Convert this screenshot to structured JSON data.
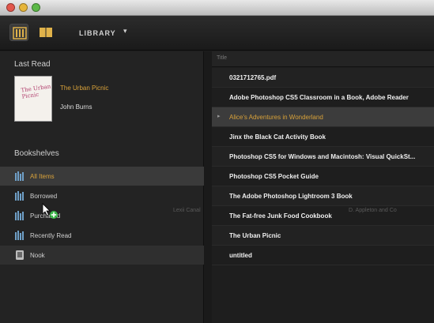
{
  "window": {
    "traffic_lights": [
      "close",
      "minimize",
      "zoom"
    ]
  },
  "toolbar": {
    "grid_view_icon": "bookshelf-grid-icon",
    "book_view_icon": "open-book-icon",
    "library_label": "LIBRARY",
    "library_caret": "▾"
  },
  "sidebar": {
    "last_read_title": "Last Read",
    "last_read": {
      "cover_text": "The Urban Picnic",
      "title": "The Urban Picnic",
      "author": "John Burns"
    },
    "bookshelves_title": "Bookshelves",
    "shelves": [
      {
        "label": "All Items",
        "selected": true
      },
      {
        "label": "Borrowed",
        "selected": false
      },
      {
        "label": "Purchased",
        "selected": false
      },
      {
        "label": "Recently Read",
        "selected": false
      },
      {
        "label": "Nook",
        "selected": false
      }
    ],
    "drop_hint": "Lexii Canal"
  },
  "list": {
    "column_header": "Title",
    "rows": [
      {
        "title": "0321712765.pdf"
      },
      {
        "title": "Adobe Photoshop CS5 Classroom in a Book, Adobe Reader"
      },
      {
        "title": "Alice's Adventures in Wonderland",
        "selected": true,
        "marker": "▸"
      },
      {
        "title": "Jinx the Black Cat Activity Book"
      },
      {
        "title": "Photoshop CS5 for Windows and Macintosh: Visual QuickSt..."
      },
      {
        "title": "Photoshop CS5 Pocket Guide"
      },
      {
        "title": "The Adobe Photoshop Lightroom 3 Book"
      },
      {
        "title": "The Fat-free Junk Food Cookbook"
      },
      {
        "title": "The Urban Picnic"
      },
      {
        "title": "untitled"
      }
    ],
    "drop_hint": "D. Appleton and Co"
  },
  "colors": {
    "accent": "#d9a23a",
    "background": "#1e1e1e",
    "sidebar": "#232323"
  }
}
